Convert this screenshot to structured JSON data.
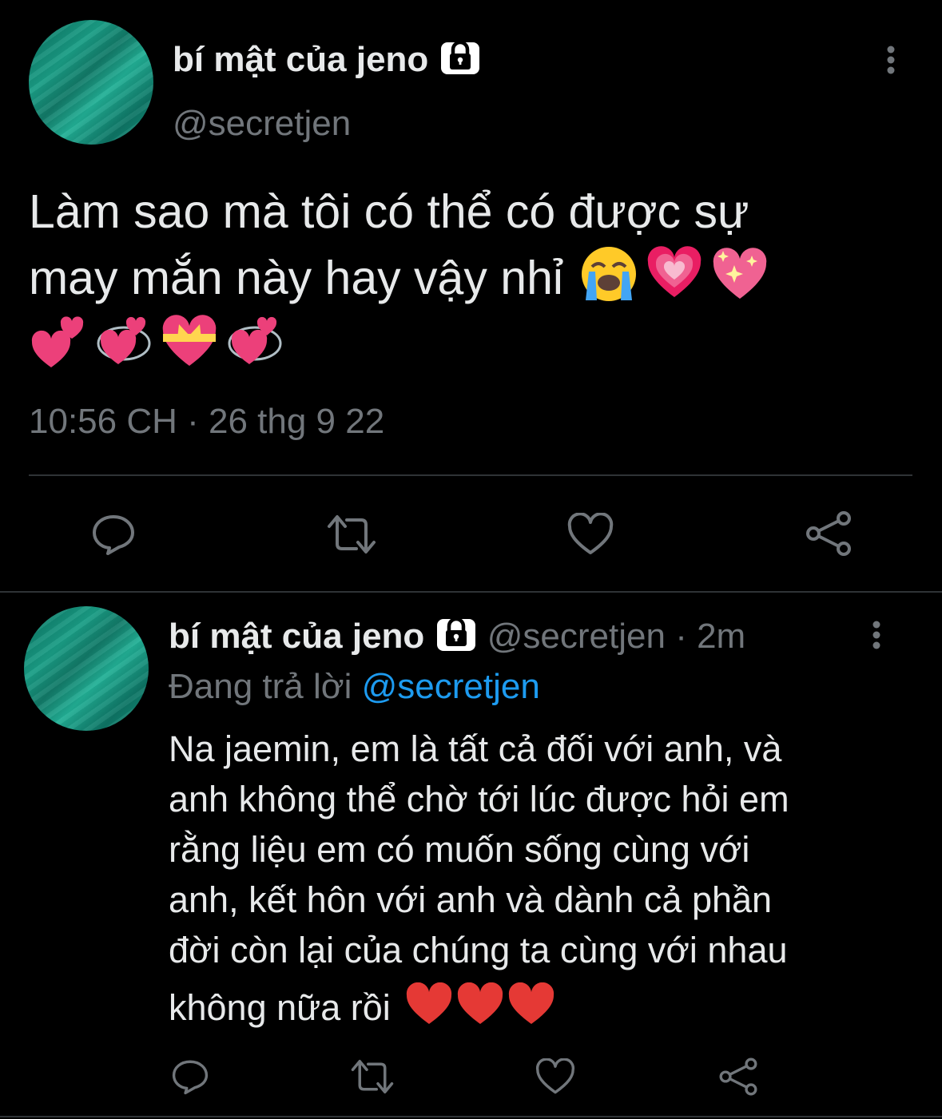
{
  "main_tweet": {
    "author_name": "bí mật của jeno",
    "handle": "@secretjen",
    "text_lines": [
      "Làm sao mà tôi có thể có được sự",
      "may mắn này hay vậy nhỉ"
    ],
    "emojis_line2": [
      "loudly-crying-face",
      "growing-heart",
      "sparkling-heart"
    ],
    "emojis_line3": [
      "two-hearts",
      "revolving-hearts",
      "heart-with-ribbon",
      "revolving-hearts"
    ],
    "timestamp": "10:56 CH",
    "separator": " · ",
    "date": "26 thg 9 22"
  },
  "reply_tweet": {
    "author_name": "bí mật của jeno",
    "handle": "@secretjen",
    "separator": " · ",
    "time_ago": "2m",
    "replying_to_label": "Đang trả lời",
    "replying_to_handle": "@secretjen",
    "text_lines": [
      "Na jaemin, em là tất cả đối với anh, và",
      "anh không thể chờ tới lúc được hỏi em",
      "rằng liệu em có muốn sống cùng với",
      "anh, kết hôn với anh và dành cả phần",
      "đời còn lại của chúng ta cùng với nhau",
      "không nữa rồi"
    ],
    "emojis_last_line": [
      "red-heart",
      "red-heart",
      "red-heart"
    ]
  },
  "actions": {
    "icons": [
      "reply-icon",
      "retweet-icon",
      "like-icon",
      "share-icon"
    ]
  },
  "colors": {
    "background": "#000000",
    "text": "#e7e9ea",
    "muted": "#71767b",
    "link": "#1d9bf0",
    "divider": "#2f3336"
  }
}
